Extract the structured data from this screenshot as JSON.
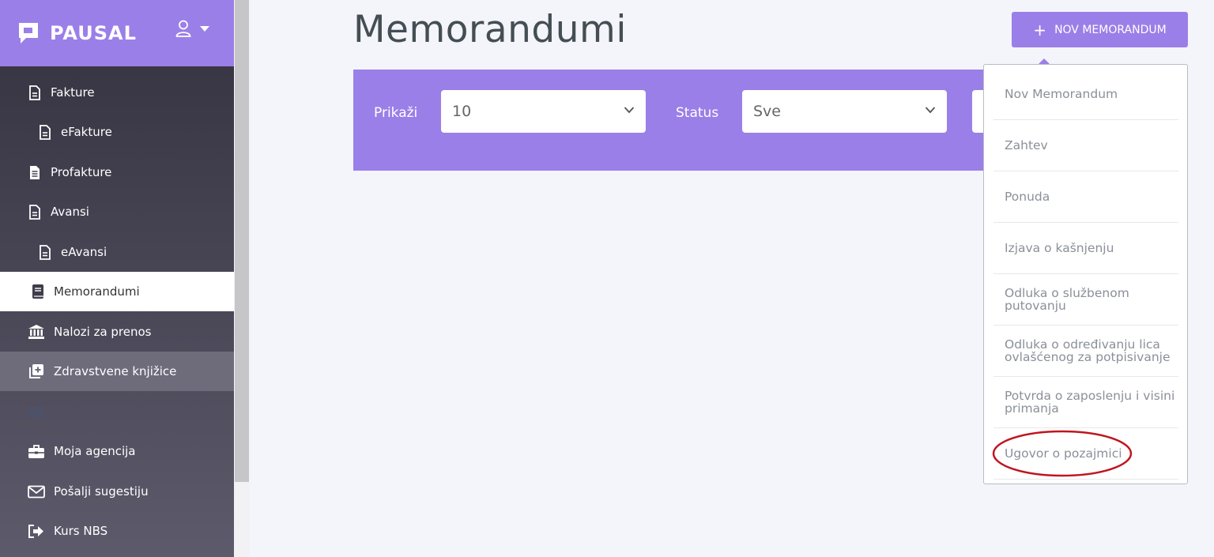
{
  "app": {
    "logo_text": "PAUSAL"
  },
  "sidebar": {
    "items": [
      {
        "label": "Fakture",
        "icon": "document-icon"
      },
      {
        "label": "eFakture",
        "icon": "document-icon"
      },
      {
        "label": "Profakture",
        "icon": "document-list-icon"
      },
      {
        "label": "Avansi",
        "icon": "document-icon"
      },
      {
        "label": "eAvansi",
        "icon": "document-icon"
      },
      {
        "label": "Memorandumi",
        "icon": "book-icon"
      },
      {
        "label": "Nalozi za prenos",
        "icon": "bank-icon"
      },
      {
        "label": "Zdravstvene knjižice",
        "icon": "add-copy-icon"
      },
      {
        "label": "",
        "icon": "calendar-icon"
      },
      {
        "label": "Moja agencija",
        "icon": "briefcase-icon"
      },
      {
        "label": "Pošalji sugestiju",
        "icon": "envelope-icon"
      },
      {
        "label": "Kurs NBS",
        "icon": "sign-out-icon"
      }
    ]
  },
  "main": {
    "title": "Memorandumi",
    "new_button": {
      "plus": "+",
      "label": "NOV MEMORANDUM"
    },
    "filters": {
      "show_label": "Prikaži",
      "show_value": "10",
      "status_label": "Status",
      "status_value": "Sve"
    }
  },
  "dropdown": {
    "items": [
      {
        "lines": [
          "Nov Memorandum"
        ]
      },
      {
        "lines": [
          "Zahtev"
        ]
      },
      {
        "lines": [
          "Ponuda"
        ]
      },
      {
        "lines": [
          "Izjava o kašnjenju"
        ]
      },
      {
        "lines": [
          "Odluka o službenom",
          "putovanju"
        ]
      },
      {
        "lines": [
          "Odluka o određivanju lica",
          "ovlašćenog za potpisivanje"
        ]
      },
      {
        "lines": [
          "Potvrda o zaposlenju i visini",
          "primanja"
        ]
      },
      {
        "lines": [
          "Ugovor o pozajmici"
        ]
      }
    ]
  },
  "colors": {
    "accent": "#9b7fe8",
    "sidebar_dark": "#34323f",
    "highlight": "#c0151f"
  }
}
